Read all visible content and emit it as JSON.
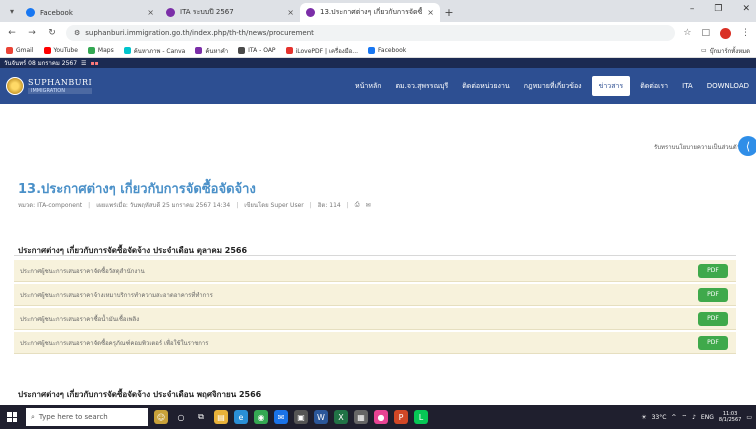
{
  "browser": {
    "tabs": [
      {
        "title": "Facebook",
        "favicon_color": "#1877f2",
        "active": false
      },
      {
        "title": "ITA ระบบปี 2567",
        "favicon_color": "#7b2ea8",
        "active": false
      },
      {
        "title": "13.ประกาศต่างๆ เกี่ยวกับการจัดซื้อ",
        "favicon_color": "#7b2ea8",
        "active": true
      }
    ],
    "new_tab": "+",
    "window_controls": [
      "–",
      "❐",
      "✕"
    ],
    "url": "suphanburi.immigration.go.th/index.php/th-th/news/procurement",
    "bookmarks": [
      {
        "label": "Gmail",
        "color": "#ea4335"
      },
      {
        "label": "YouTube",
        "color": "#ff0000"
      },
      {
        "label": "Maps",
        "color": "#34a853"
      },
      {
        "label": "ค้นหาภาพ - Canva",
        "color": "#00c4cc"
      },
      {
        "label": "ค้นหาคำ",
        "color": "#7b2ea8"
      },
      {
        "label": "ITA - OAP",
        "color": "#4a4a4a"
      },
      {
        "label": "iLovePDF | เครื่องมือ...",
        "color": "#e5322d"
      },
      {
        "label": "Facebook",
        "color": "#1877f2"
      }
    ],
    "bookmarks_right": "บุ๊กมาร์กทั้งหมด"
  },
  "site": {
    "topbar_text": "วันจันทร์ 08 มกราคม 2567",
    "logo_line1": "SUPHANBURI",
    "logo_line2": "IMMIGRATION",
    "nav": [
      {
        "label": "หน้าหลัก",
        "active": false
      },
      {
        "label": "ตม.จว.สุพรรณบุรี",
        "active": false
      },
      {
        "label": "ติดต่อหน่วยงาน",
        "active": false
      },
      {
        "label": "กฎหมายที่เกี่ยวข้อง",
        "active": false
      },
      {
        "label": "ข่าวสาร",
        "active": true
      },
      {
        "label": "ติดต่อเรา",
        "active": false
      },
      {
        "label": "ITA",
        "active": false
      },
      {
        "label": "DOWNLOAD",
        "active": false
      }
    ],
    "top_right_link": "รับทราบนโยบายความเป็นส่วนตัว"
  },
  "main": {
    "title": "13.ประกาศต่างๆ เกี่ยวกับการจัดซื้อจัดจ้าง",
    "meta": {
      "category": "หมวด: ITA-component",
      "published": "เผยแพร่เมื่อ: วันพฤหัสบดี 25 มกราคม 2567 14:34",
      "author": "เขียนโดย Super User",
      "hits": "ฮิต: 114"
    },
    "section1_title": "ประกาศต่างๆ เกี่ยวกับการจัดซื้อจัดจ้าง ประจำเดือน ตุลาคม 2566",
    "rows": [
      {
        "text": "ประกาศผู้ชนะการเสนอราคาจัดซื้อวัสดุสำนักงาน",
        "button": "PDF"
      },
      {
        "text": "ประกาศผู้ชนะการเสนอราคาจ้างเหมาบริการทำความสะอาดอาคารที่ทำการ",
        "button": "PDF"
      },
      {
        "text": "ประกาศผู้ชนะการเสนอราคาซื้อน้ำมันเชื้อเพลิง",
        "button": "PDF"
      },
      {
        "text": "ประกาศผู้ชนะการเสนอราคาจัดซื้อครุภัณฑ์คอมพิวเตอร์ เพื่อใช้ในราชการ",
        "button": "PDF"
      }
    ],
    "section2_title": "ประกาศต่างๆ เกี่ยวกับการจัดซื้อจัดจ้าง ประจำเดือน พฤศจิกายน 2566"
  },
  "taskbar": {
    "search_placeholder": "Type here to search",
    "weather": "33°C",
    "lang": "ENG",
    "time": "11:03",
    "date": "8/1/2567"
  },
  "colors": {
    "header_bg": "#2d4f92",
    "row_bg": "#f7f2dc",
    "pdf_green": "#3fa94b",
    "title_blue": "#4a90c8"
  }
}
